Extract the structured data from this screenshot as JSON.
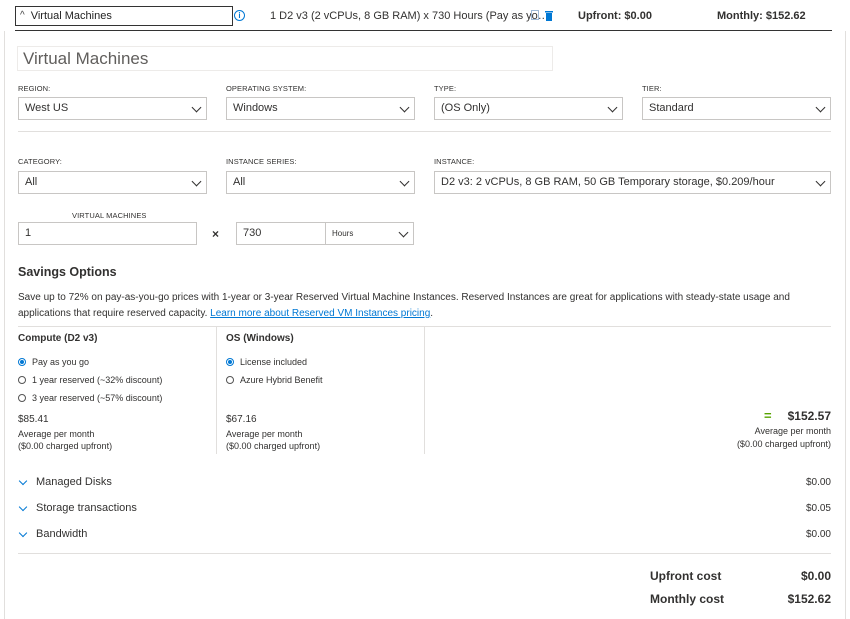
{
  "header": {
    "service_label": "Virtual Machines",
    "description": "1 D2 v3 (2 vCPUs, 8 GB RAM) x 730 Hours (Pay as yo…",
    "upfront": "Upfront: $0.00",
    "monthly": "Monthly: $152.62"
  },
  "title": "Virtual Machines",
  "fields": {
    "region": {
      "label": "REGION:",
      "value": "West US"
    },
    "os": {
      "label": "OPERATING SYSTEM:",
      "value": "Windows"
    },
    "type": {
      "label": "TYPE:",
      "value": "(OS Only)"
    },
    "tier": {
      "label": "TIER:",
      "value": "Standard"
    },
    "category": {
      "label": "CATEGORY:",
      "value": "All"
    },
    "series": {
      "label": "INSTANCE SERIES:",
      "value": "All"
    },
    "instance": {
      "label": "INSTANCE:",
      "value": "D2 v3: 2 vCPUs, 8 GB RAM, 50 GB Temporary storage, $0.209/hour"
    },
    "vms": {
      "label": "VIRTUAL MACHINES",
      "value": "1"
    },
    "multiply": "×",
    "hours": {
      "value": "730",
      "unit": "Hours"
    }
  },
  "savings": {
    "heading": "Savings Options",
    "text": "Save up to 72% on pay-as-you-go prices with 1-year or 3-year Reserved Virtual Machine Instances. Reserved Instances are great for applications with steady-state usage and applications that require reserved capacity.",
    "link": "Learn more about Reserved VM Instances pricing",
    "link_suffix": ".",
    "compute": {
      "heading": "Compute (D2 v3)",
      "options": [
        "Pay as you go",
        "1 year reserved (~32% discount)",
        "3 year reserved (~57% discount)"
      ],
      "price": "$85.41",
      "avg": "Average per month",
      "upfront": "($0.00 charged upfront)"
    },
    "os": {
      "heading": "OS (Windows)",
      "options": [
        "License included",
        "Azure Hybrid Benefit"
      ],
      "price": "$67.16",
      "avg": "Average per month",
      "upfront": "($0.00 charged upfront)"
    },
    "total": {
      "equals": "=",
      "price": "$152.57",
      "avg": "Average per month",
      "upfront": "($0.00 charged upfront)"
    }
  },
  "sections": [
    {
      "label": "Managed Disks",
      "value": "$0.00"
    },
    {
      "label": "Storage transactions",
      "value": "$0.05"
    },
    {
      "label": "Bandwidth",
      "value": "$0.00"
    }
  ],
  "totals": {
    "upfront_label": "Upfront cost",
    "upfront_value": "$0.00",
    "monthly_label": "Monthly cost",
    "monthly_value": "$152.62"
  },
  "colors": {
    "accent": "#0078d4",
    "equals": "#57a300"
  }
}
